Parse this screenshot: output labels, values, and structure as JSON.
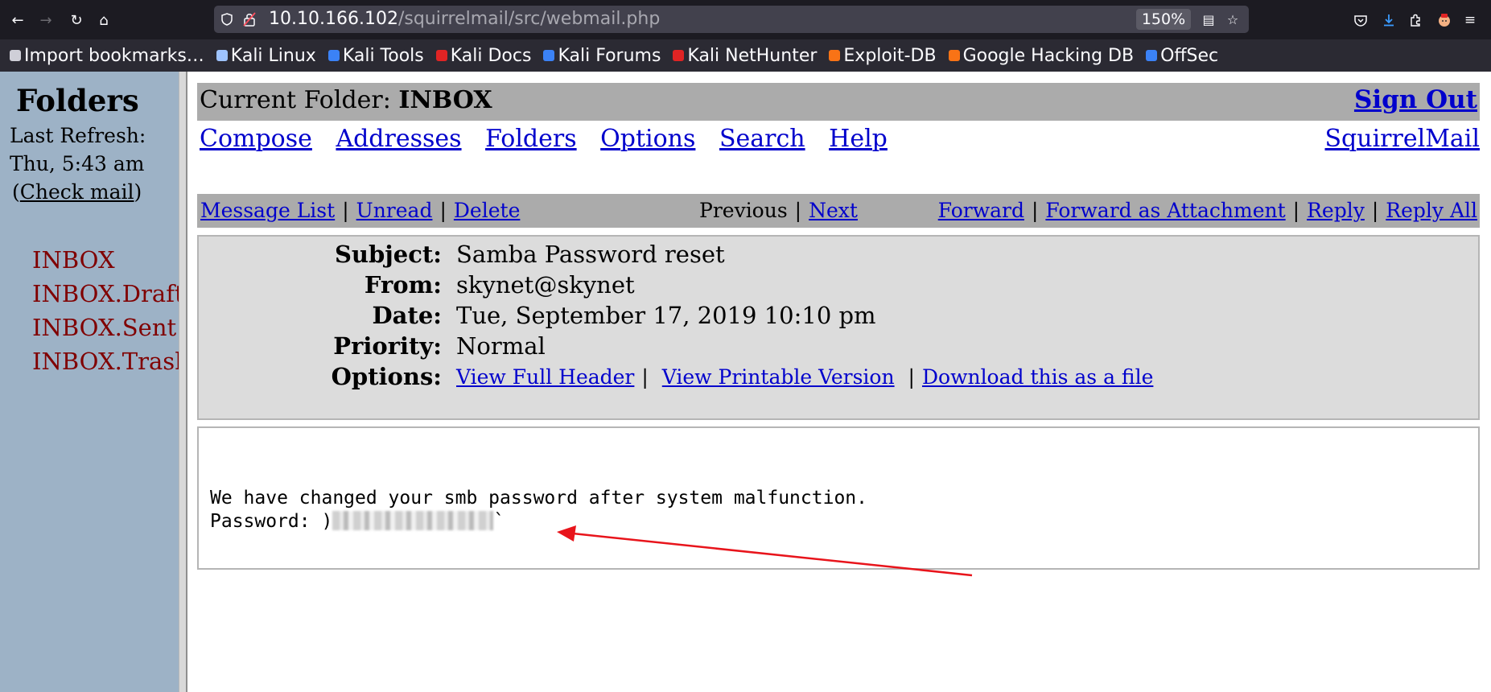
{
  "browser": {
    "url_host": "10.10.166.102",
    "url_path": "/squirrelmail/src/webmail.php",
    "zoom": "150%",
    "bookmarks": [
      {
        "label": "Import bookmarks…",
        "icon": "import-icon",
        "color": "#cfcfd8"
      },
      {
        "label": "Kali Linux",
        "icon": "kali-dragon-icon",
        "color": "#9ec3ff"
      },
      {
        "label": "Kali Tools",
        "icon": "kali-tools-icon",
        "color": "#3b82f6"
      },
      {
        "label": "Kali Docs",
        "icon": "kali-docs-icon",
        "color": "#e02424"
      },
      {
        "label": "Kali Forums",
        "icon": "kali-forums-icon",
        "color": "#3b82f6"
      },
      {
        "label": "Kali NetHunter",
        "icon": "nethunter-icon",
        "color": "#e02424"
      },
      {
        "label": "Exploit-DB",
        "icon": "exploit-db-icon",
        "color": "#f97316"
      },
      {
        "label": "Google Hacking DB",
        "icon": "ghdb-icon",
        "color": "#f97316"
      },
      {
        "label": "OffSec",
        "icon": "offsec-icon",
        "color": "#3b82f6"
      }
    ]
  },
  "left": {
    "title": "Folders",
    "last_refresh_label": "Last Refresh:",
    "last_refresh_time": "Thu, 5:43 am",
    "check_mail": "Check mail",
    "folders": [
      "INBOX",
      "INBOX.Drafts",
      "INBOX.Sent",
      "INBOX.Trash"
    ]
  },
  "header": {
    "current_folder_label": "Current Folder:",
    "current_folder": "INBOX",
    "sign_out": "Sign Out",
    "menu": [
      "Compose",
      "Addresses",
      "Folders",
      "Options",
      "Search",
      "Help"
    ],
    "brand_link": "SquirrelMail"
  },
  "message_nav": {
    "message_list": "Message List",
    "unread": "Unread",
    "delete": "Delete",
    "previous": "Previous",
    "next": "Next",
    "forward": "Forward",
    "forward_attachment": "Forward as Attachment",
    "reply": "Reply",
    "reply_all": "Reply All"
  },
  "message": {
    "subject_label": "Subject:",
    "subject": "Samba Password reset",
    "from_label": "From:",
    "from": "skynet@skynet",
    "date_label": "Date:",
    "date": "Tue, September 17, 2019 10:10 pm",
    "priority_label": "Priority:",
    "priority": "Normal",
    "options_label": "Options:",
    "view_full_header": "View Full Header",
    "view_printable": "View Printable Version",
    "download": "Download this as a file",
    "body_line1": "We have changed your smb password after system malfunction.",
    "body_password_label": "Password: )",
    "body_password_tail": "`"
  },
  "annotation": {
    "arrow_color": "#e8141b"
  }
}
